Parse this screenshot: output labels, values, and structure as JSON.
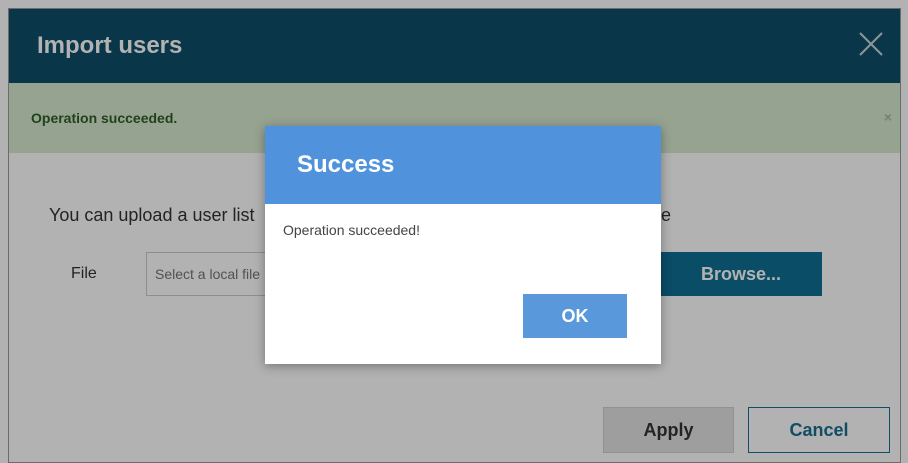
{
  "dialog": {
    "title": "Import users",
    "alert_message": "Operation succeeded.",
    "alert_dismiss": "×",
    "description_start": "You can upload a user list",
    "description_end": "e",
    "file_label": "File",
    "file_placeholder": "Select a local file",
    "browse_label": "Browse...",
    "apply_label": "Apply",
    "cancel_label": "Cancel"
  },
  "modal": {
    "title": "Success",
    "message": "Operation succeeded!",
    "ok_label": "OK"
  },
  "colors": {
    "title_bar": "#0d4e67",
    "alert_bg": "#d9ead0",
    "modal_header": "#5093dc",
    "browse_button": "#0f6f94",
    "ok_button": "#5a98dc"
  },
  "icons": {
    "close": "close-icon",
    "alert_dismiss": "close-icon"
  }
}
